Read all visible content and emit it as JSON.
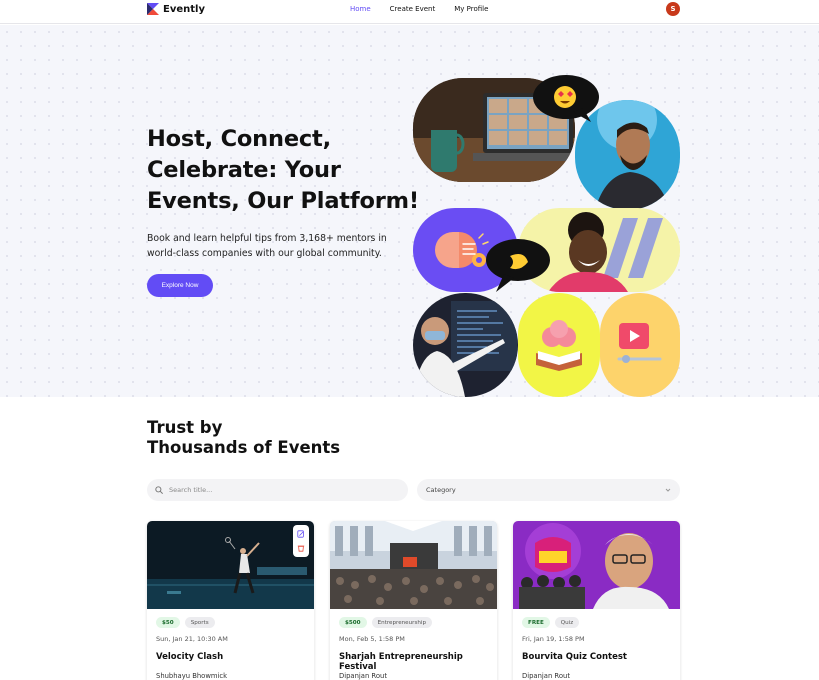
{
  "header": {
    "logo_text": "Evently",
    "nav": [
      {
        "label": "Home",
        "active": true
      },
      {
        "label": "Create Event",
        "active": false
      },
      {
        "label": "My Profile",
        "active": false
      }
    ],
    "avatar_initial": "S"
  },
  "hero": {
    "title": "Host, Connect, Celebrate: Your Events, Our Platform!",
    "subtitle": "Book and learn helpful tips from 3,168+ mentors in world-class companies with our global community.",
    "cta_label": "Explore Now"
  },
  "trust": {
    "title_line1": "Trust by",
    "title_line2": "Thousands of Events"
  },
  "filters": {
    "search_placeholder": "Search title...",
    "category_label": "Category"
  },
  "events": [
    {
      "price": "$50",
      "category": "Sports",
      "date": "Sun, Jan 21, 10:30 AM",
      "title": "Velocity Clash",
      "author": "Shubhayu Bhowmick"
    },
    {
      "price": "$500",
      "category": "Entrepreneurship",
      "date": "Mon, Feb 5, 1:58 PM",
      "title": "Sharjah Entrepreneurship Festival",
      "author": "Dipanjan Rout"
    },
    {
      "price": "FREE",
      "category": "Quiz",
      "date": "Fri, Jan 19, 1:58 PM",
      "title": "Bourvita Quiz Contest",
      "author": "Dipanjan Rout"
    }
  ],
  "colors": {
    "accent": "#624cf5",
    "hero_bg": "#f5f6fb",
    "avatar": "#c8391b",
    "price_badge_bg": "#e2f7e6"
  }
}
